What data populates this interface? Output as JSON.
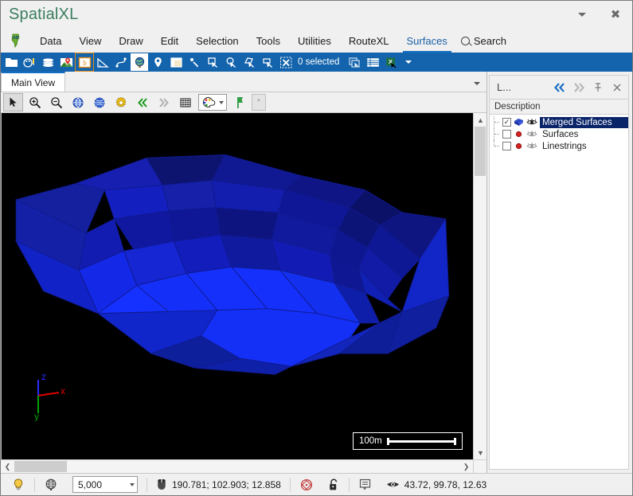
{
  "window": {
    "app_title": "SpatialXL",
    "app_icon": "africa-map-icon",
    "dropdown_label": "▾",
    "close_label": "✕"
  },
  "menubar": {
    "app_button_icon": "africa-map-icon",
    "items": [
      {
        "label": "Data",
        "active": false
      },
      {
        "label": "View",
        "active": false
      },
      {
        "label": "Draw",
        "active": false
      },
      {
        "label": "Edit",
        "active": false
      },
      {
        "label": "Selection",
        "active": false
      },
      {
        "label": "Tools",
        "active": false
      },
      {
        "label": "Utilities",
        "active": false
      },
      {
        "label": "RouteXL",
        "active": false
      },
      {
        "label": "Surfaces",
        "active": true
      }
    ],
    "search_label": "Search",
    "search_icon": "search-icon"
  },
  "main_toolbar": {
    "selection_count_label": "0 selected",
    "buttons": [
      {
        "name": "open-folder-icon"
      },
      {
        "name": "palette-pencil-icon"
      },
      {
        "name": "layers-stack-icon"
      },
      {
        "name": "map-pin-image-icon"
      },
      {
        "name": "boundary-box-icon"
      },
      {
        "name": "measure-angle-icon"
      },
      {
        "name": "curve-node-icon"
      },
      {
        "name": "globe-icon"
      },
      {
        "name": "location-pin-icon"
      },
      {
        "name": "window-frame-icon"
      },
      {
        "name": "select-point-icon"
      },
      {
        "name": "select-rectangle-icon"
      },
      {
        "name": "select-circle-icon"
      },
      {
        "name": "select-polygon-icon"
      },
      {
        "name": "select-fence-icon"
      },
      {
        "name": "clear-selection-icon"
      },
      {
        "name": "copy-to-clipboard-icon"
      },
      {
        "name": "table-view-icon"
      },
      {
        "name": "export-excel-icon"
      }
    ],
    "overflow_icon": "chevron-down-icon"
  },
  "doc_tabs": {
    "tabs": [
      {
        "label": "Main View",
        "active": true
      }
    ],
    "overflow_icon": "chevron-down-icon"
  },
  "view_toolbar": {
    "buttons": [
      {
        "name": "pointer-select-icon",
        "pressed": true
      },
      {
        "name": "zoom-in-icon",
        "pressed": false
      },
      {
        "name": "zoom-out-icon",
        "pressed": false
      },
      {
        "name": "globe-rotate-icon",
        "pressed": false
      },
      {
        "name": "globe-dashed-icon",
        "pressed": false
      },
      {
        "name": "settings-gear-icon",
        "pressed": false
      },
      {
        "name": "previous-view-icon",
        "pressed": false
      },
      {
        "name": "next-view-icon",
        "pressed": false
      },
      {
        "name": "grid-icon",
        "pressed": false
      }
    ],
    "palette_icon": "color-palette-icon",
    "palette_caret_icon": "chevron-down-icon",
    "flag_icon": "green-flag-icon",
    "extra_label": "*"
  },
  "viewport": {
    "scale_bar_label": "100m",
    "background_color": "#000000",
    "surface_color": "#0b16c8",
    "axes": [
      {
        "label": "z",
        "color": "#2b2bff"
      },
      {
        "label": "x",
        "color": "#e00000"
      },
      {
        "label": "y",
        "color": "#00a000"
      }
    ]
  },
  "dock": {
    "title": "L...",
    "back_icon": "double-chevron-left-icon",
    "forward_icon": "double-chevron-right-icon",
    "pin_icon": "pin-icon",
    "close_icon": "close-icon",
    "tree_header": "Description",
    "rows": [
      {
        "label": "Merged Surfaces",
        "checked": true,
        "selected": true,
        "shape_icon": "blue-surface-icon",
        "visibility_icon": "eye-open-icon"
      },
      {
        "label": "Surfaces",
        "checked": false,
        "selected": false,
        "shape_icon": "red-point-icon",
        "visibility_icon": "eye-closed-icon"
      },
      {
        "label": "Linestrings",
        "checked": false,
        "selected": false,
        "shape_icon": "red-point-icon",
        "visibility_icon": "eye-closed-icon"
      }
    ]
  },
  "statusbar": {
    "lightbulb_icon": "lightbulb-icon",
    "globe_icon": "globe-wireframe-icon",
    "scale_value": "5,000",
    "scale_caret_icon": "chevron-down-icon",
    "mouse_icon": "mouse-icon",
    "mouse_coordinates": "190.781; 102.903; 12.858",
    "snap_icon": "snap-target-icon",
    "lock_icon": "unlock-icon",
    "message_icon": "message-icon",
    "eye_icon": "eye-icon",
    "camera_coordinates": "43.72, 99.78, 12.63"
  }
}
